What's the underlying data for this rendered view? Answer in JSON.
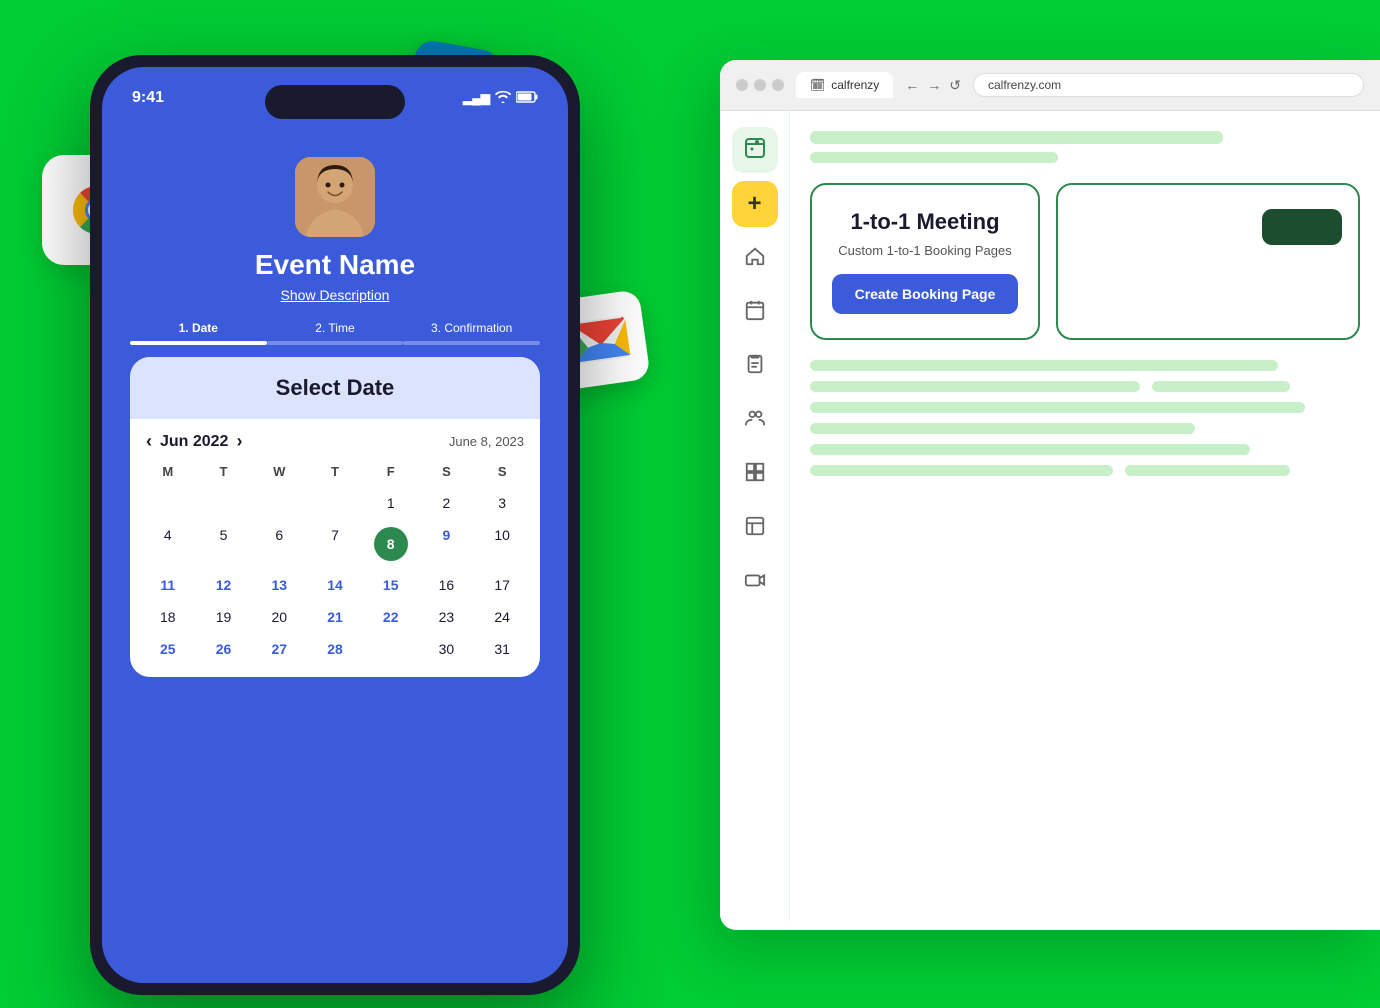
{
  "background": {
    "color": "#00cc33"
  },
  "floating_icons": {
    "chrome_label": "Chrome",
    "linkedin_label": "LinkedIn",
    "gmail_label": "Gmail"
  },
  "phone": {
    "status_time": "9:41",
    "status_signal": "▂▄▆",
    "status_wifi": "wifi",
    "status_battery": "battery",
    "event_name": "Event Name",
    "show_description": "Show Description",
    "steps": [
      {
        "label": "1. Date",
        "active": true
      },
      {
        "label": "2. Time",
        "active": false
      },
      {
        "label": "3. Confirmation",
        "active": false
      }
    ],
    "calendar": {
      "select_date_label": "Select Date",
      "month": "Jun 2022",
      "today_label": "June 8, 2023",
      "day_names": [
        "M",
        "T",
        "W",
        "T",
        "F",
        "S",
        "S"
      ],
      "weeks": [
        [
          "",
          "",
          "",
          "",
          "1",
          "2",
          "3"
        ],
        [
          "4",
          "5",
          "6",
          "7",
          "8",
          "9",
          "10"
        ],
        [
          "11",
          "12",
          "13",
          "14",
          "15",
          "16",
          "17"
        ],
        [
          "18",
          "19",
          "20",
          "21",
          "22",
          "23",
          "24"
        ],
        [
          "25",
          "26",
          "27",
          "28",
          "30",
          "31",
          ""
        ]
      ],
      "selected_day": "8",
      "blue_days": [
        "9",
        "11",
        "12",
        "13",
        "14",
        "15",
        "21",
        "22",
        "25",
        "26",
        "27",
        "28"
      ]
    }
  },
  "browser": {
    "tab_label": "calfrenzy",
    "url": "calfrenzy.com",
    "nav_back": "←",
    "nav_forward": "→",
    "nav_refresh": "↺"
  },
  "sidebar": {
    "items": [
      {
        "icon": "📅",
        "active": true,
        "name": "calendar-icon"
      },
      {
        "icon": "+",
        "active": false,
        "yellow": true,
        "name": "add-icon"
      },
      {
        "icon": "🏠",
        "active": false,
        "name": "home-icon"
      },
      {
        "icon": "📆",
        "active": false,
        "name": "schedule-icon"
      },
      {
        "icon": "📋",
        "active": false,
        "name": "clipboard-icon"
      },
      {
        "icon": "👥",
        "active": false,
        "name": "team-icon"
      },
      {
        "icon": "⊞",
        "active": false,
        "name": "grid-icon"
      },
      {
        "icon": "📊",
        "active": false,
        "name": "chart-icon"
      },
      {
        "icon": "🎥",
        "active": false,
        "name": "video-icon"
      }
    ]
  },
  "main_content": {
    "meeting_card": {
      "title": "1-to-1 Meeting",
      "subtitle": "Custom 1-to-1 Booking Pages",
      "create_button_label": "Create Booking Page"
    },
    "skeleton_rows_top": [
      {
        "width": "75%"
      },
      {
        "width": "45%"
      }
    ],
    "skeleton_rows_bottom": [
      {
        "width": "85%"
      },
      {
        "width": "60%"
      },
      {
        "width": "90%"
      },
      {
        "width": "70%"
      },
      {
        "width": "80%"
      },
      {
        "width": "55%"
      }
    ]
  }
}
